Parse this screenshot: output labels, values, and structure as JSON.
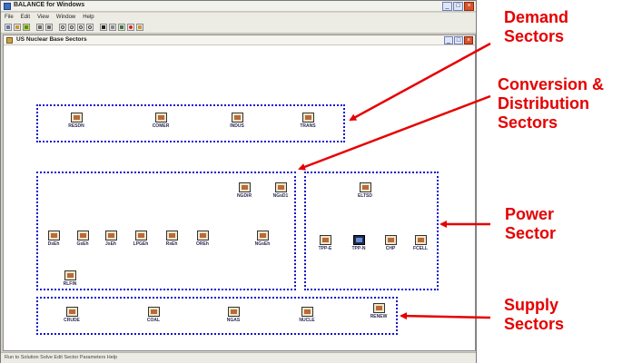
{
  "window": {
    "title": "BALANCE for Windows",
    "controls": [
      "_",
      "□",
      "×"
    ]
  },
  "menu": [
    "File",
    "Edit",
    "View",
    "Window",
    "Help"
  ],
  "toolbar": {
    "icons": [
      "new-icon",
      "open-icon",
      "save-icon",
      "cut-icon",
      "copy-icon",
      "zoom-icon",
      "zoom-in-icon",
      "zoom-out-icon",
      "zoom-fit-icon",
      "find-icon",
      "print-icon",
      "run-icon",
      "record-icon",
      "help-icon"
    ]
  },
  "child_window": {
    "title": "US Nuclear Base Sectors",
    "controls": [
      "_",
      "□",
      "×"
    ]
  },
  "status": {
    "text": "Run to Solution  Solve  Edit Sector Parameters  Help"
  },
  "groups": {
    "demand": [
      "RESDN",
      "COMER",
      "INDUS",
      "TRANS"
    ],
    "conversion_top": [
      "NGDiR",
      "NGsD1"
    ],
    "conversion_row": [
      "DsEh",
      "GsEh",
      "JsEh",
      "LPGEh",
      "RsEh",
      "OREh",
      "NGsEh"
    ],
    "conversion_bottom": [
      "RLFIN"
    ],
    "power_top": [
      "ELTSD"
    ],
    "power_row": [
      "TPP-E",
      "TPP-N",
      "CHP",
      "FCELL"
    ],
    "supply": [
      "CRUDE",
      "COAL",
      "NGAS",
      "NUCLE",
      "RENEW"
    ]
  },
  "annotations": {
    "demand_line1": "Demand",
    "demand_line2": "Sectors",
    "conversion_line1": "Conversion &",
    "conversion_line2": "Distribution",
    "conversion_line3": "Sectors",
    "power_line1": "Power",
    "power_line2": "Sector",
    "supply_line1": "Supply",
    "supply_line2": "Sectors"
  },
  "colors": {
    "annotation": "#e60000",
    "group_border": "#1414d2",
    "node_label": "#2a2a55"
  }
}
